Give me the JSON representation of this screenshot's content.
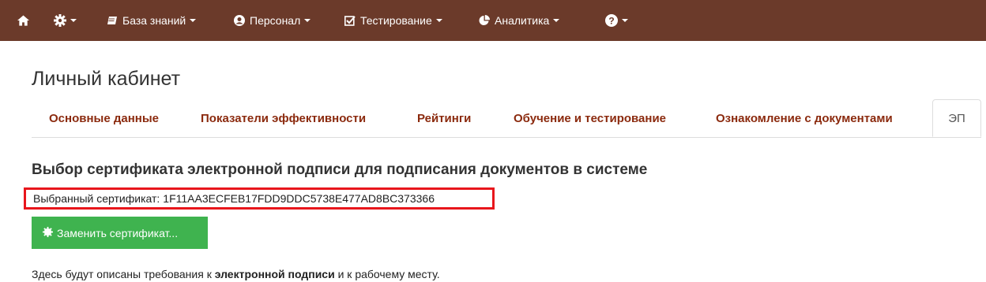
{
  "navbar": {
    "bg_color": "#6b3a2a",
    "items": [
      {
        "icon": "home-icon",
        "label": ""
      },
      {
        "icon": "gear-icon",
        "label": ""
      },
      {
        "icon": "book-icon",
        "label": "База знаний"
      },
      {
        "icon": "user-circle-icon",
        "label": "Персонал"
      },
      {
        "icon": "check-square-icon",
        "label": "Тестирование"
      },
      {
        "icon": "pie-chart-icon",
        "label": "Аналитика"
      },
      {
        "icon": "question-circle-icon",
        "label": ""
      }
    ]
  },
  "page": {
    "title": "Личный кабинет"
  },
  "tabs": [
    {
      "label": "Основные данные"
    },
    {
      "label": "Показатели эффективности"
    },
    {
      "label": "Рейтинги"
    },
    {
      "label": "Обучение и тестирование"
    },
    {
      "label": "Ознакомление с документами"
    },
    {
      "label": "ЭП",
      "active": true
    }
  ],
  "tab_color": "#8b2a0e",
  "main": {
    "section_title": "Выбор сертификата электронной подписи для подписания документов в системе",
    "selected_cert_label": "Выбранный сертификат:",
    "selected_cert_value": "1F11AA3ECFEB17FDD9DDC5738E477AD8BC373366",
    "highlight_color": "#e8161c",
    "replace_button_label": "Заменить сертификат...",
    "button_color": "#3fb34f",
    "note_prefix": "Здесь будут описаны требования к ",
    "note_bold": "электронной подписи",
    "note_suffix": " и к рабочему месту."
  }
}
